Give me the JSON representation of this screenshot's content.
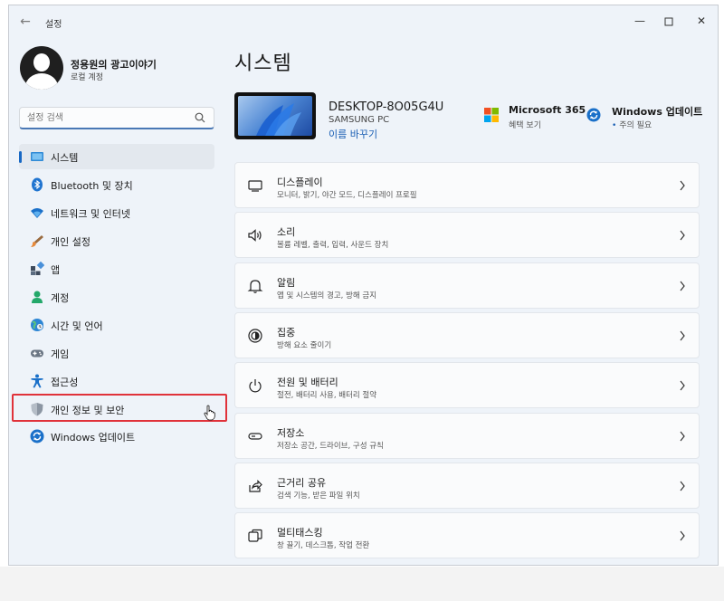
{
  "titlebar": {
    "app_title": "설정",
    "back_icon": "back-arrow-icon",
    "minimize_icon": "minimize-icon",
    "maximize_icon": "maximize-icon",
    "close_icon": "close-icon"
  },
  "profile": {
    "name": "정용원의 광고이야기",
    "account_type": "로컬 계정"
  },
  "search": {
    "placeholder": "설정 검색",
    "value": ""
  },
  "sidebar": {
    "items": [
      {
        "label": "시스템",
        "icon": "system-icon",
        "selected": true
      },
      {
        "label": "Bluetooth 및 장치",
        "icon": "bluetooth-icon",
        "selected": false
      },
      {
        "label": "네트워크 및 인터넷",
        "icon": "wifi-icon",
        "selected": false
      },
      {
        "label": "개인 설정",
        "icon": "brush-icon",
        "selected": false
      },
      {
        "label": "앱",
        "icon": "apps-icon",
        "selected": false
      },
      {
        "label": "계정",
        "icon": "account-icon",
        "selected": false
      },
      {
        "label": "시간 및 언어",
        "icon": "globe-clock-icon",
        "selected": false
      },
      {
        "label": "게임",
        "icon": "gamepad-icon",
        "selected": false
      },
      {
        "label": "접근성",
        "icon": "accessibility-icon",
        "selected": false
      },
      {
        "label": "개인 정보 및 보안",
        "icon": "shield-icon",
        "selected": false
      },
      {
        "label": "Windows 업데이트",
        "icon": "update-icon",
        "selected": false
      }
    ]
  },
  "main": {
    "title": "시스템",
    "device": {
      "name": "DESKTOP-8O05G4U",
      "model": "SAMSUNG PC",
      "rename_label": "이름 바꾸기"
    },
    "ms365": {
      "title": "Microsoft 365",
      "subtitle": "혜택 보기"
    },
    "windows_update": {
      "title": "Windows 업데이트",
      "subtitle": "주의 필요",
      "dot": "•"
    },
    "rows": [
      {
        "title": "디스플레이",
        "subtitle": "모니터, 밝기, 야간 모드, 디스플레이 프로필",
        "icon": "display-icon"
      },
      {
        "title": "소리",
        "subtitle": "볼륨 레벨, 출력, 입력, 사운드 장치",
        "icon": "speaker-icon"
      },
      {
        "title": "알림",
        "subtitle": "앱 및 시스템의 경고, 방해 금지",
        "icon": "bell-icon"
      },
      {
        "title": "집중",
        "subtitle": "방해 요소 줄이기",
        "icon": "focus-icon"
      },
      {
        "title": "전원 및 배터리",
        "subtitle": "절전, 배터리 사용, 배터리 절약",
        "icon": "power-icon"
      },
      {
        "title": "저장소",
        "subtitle": "저장소 공간, 드라이브, 구성 규칙",
        "icon": "storage-icon"
      },
      {
        "title": "근거리 공유",
        "subtitle": "검색 기능, 받은 파일 위치",
        "icon": "share-icon"
      },
      {
        "title": "멀티태스킹",
        "subtitle": "창 끌기, 데스크톱, 작업 전환",
        "icon": "multitask-icon"
      }
    ]
  },
  "colors": {
    "accent": "#1868c4",
    "highlight_border": "#e0323a",
    "window_bg": "#eef3f9"
  }
}
